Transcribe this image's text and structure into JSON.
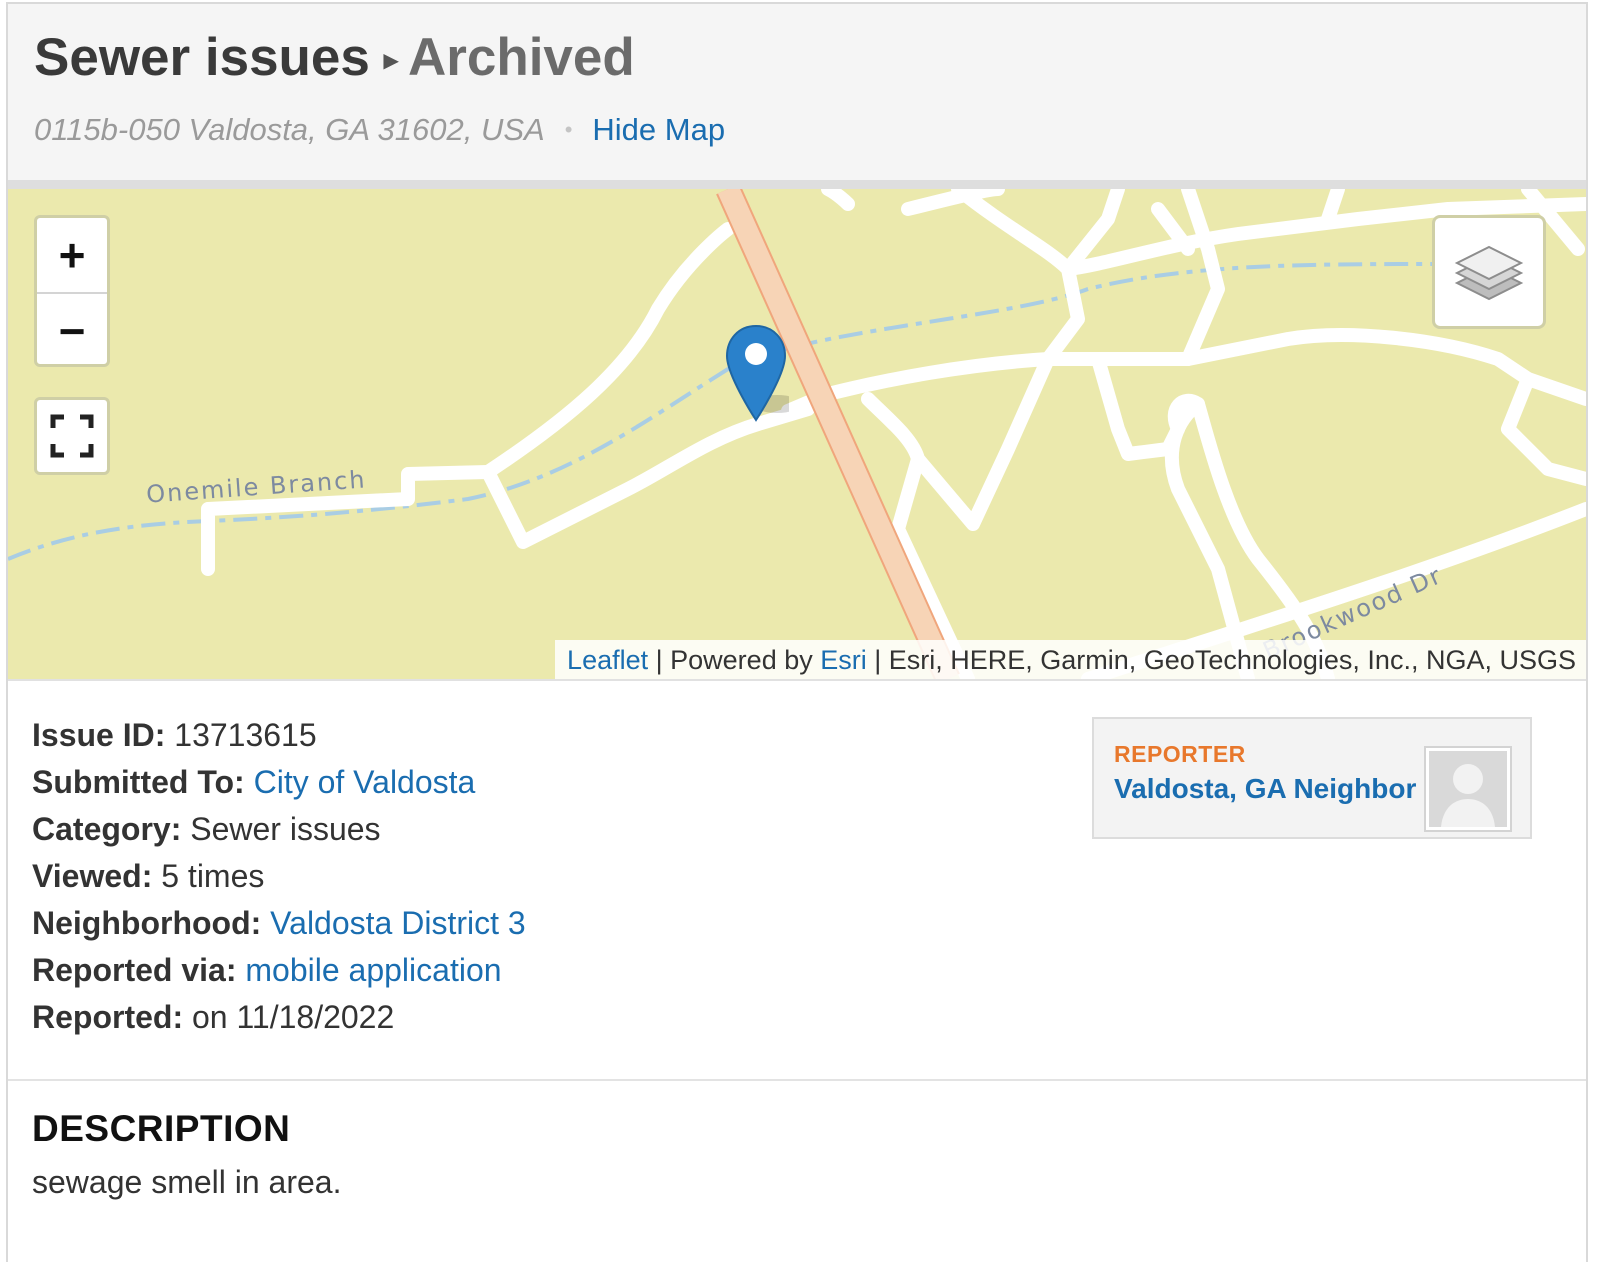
{
  "header": {
    "category": "Sewer issues",
    "separator": "▸",
    "status": "Archived",
    "address": "0115b-050 Valdosta, GA 31602, USA",
    "bullet": "•",
    "hide_map_label": "Hide Map"
  },
  "map": {
    "zoom_in_label": "+",
    "zoom_out_label": "−",
    "fullscreen_icon": "fullscreen-icon",
    "layers_icon": "layers-icon",
    "marker_icon": "map-marker-icon",
    "labels": {
      "stream": "Onemile Branch",
      "street": "Brookwood Dr"
    },
    "attribution": {
      "leaflet_link": "Leaflet",
      "sep1": " | Powered by ",
      "esri_link": "Esri",
      "sources": " | Esri, HERE, Garmin, GeoTechnologies, Inc., NGA, USGS"
    },
    "colors": {
      "land": "#ebe9ad",
      "road": "#ffffff",
      "highway": "#f4c9a6",
      "water": "#a9cde4",
      "marker": "#2a81cb"
    }
  },
  "details": {
    "issue_id": {
      "label": "Issue ID:",
      "value": "13713615"
    },
    "submitted_to": {
      "label": "Submitted To:",
      "value": "City of Valdosta"
    },
    "category": {
      "label": "Category:",
      "value": "Sewer issues"
    },
    "viewed": {
      "label": "Viewed:",
      "value": "5 times"
    },
    "neighborhood": {
      "label": "Neighborhood:",
      "value": "Valdosta District 3"
    },
    "reported_via": {
      "label": "Reported via:",
      "value": "mobile application"
    },
    "reported": {
      "label": "Reported:",
      "value": "on 11/18/2022"
    }
  },
  "reporter": {
    "label": "REPORTER",
    "name": "Valdosta, GA Neighbor",
    "avatar_icon": "user-avatar-icon"
  },
  "description": {
    "heading": "DESCRIPTION",
    "body": "sewage smell in area."
  }
}
